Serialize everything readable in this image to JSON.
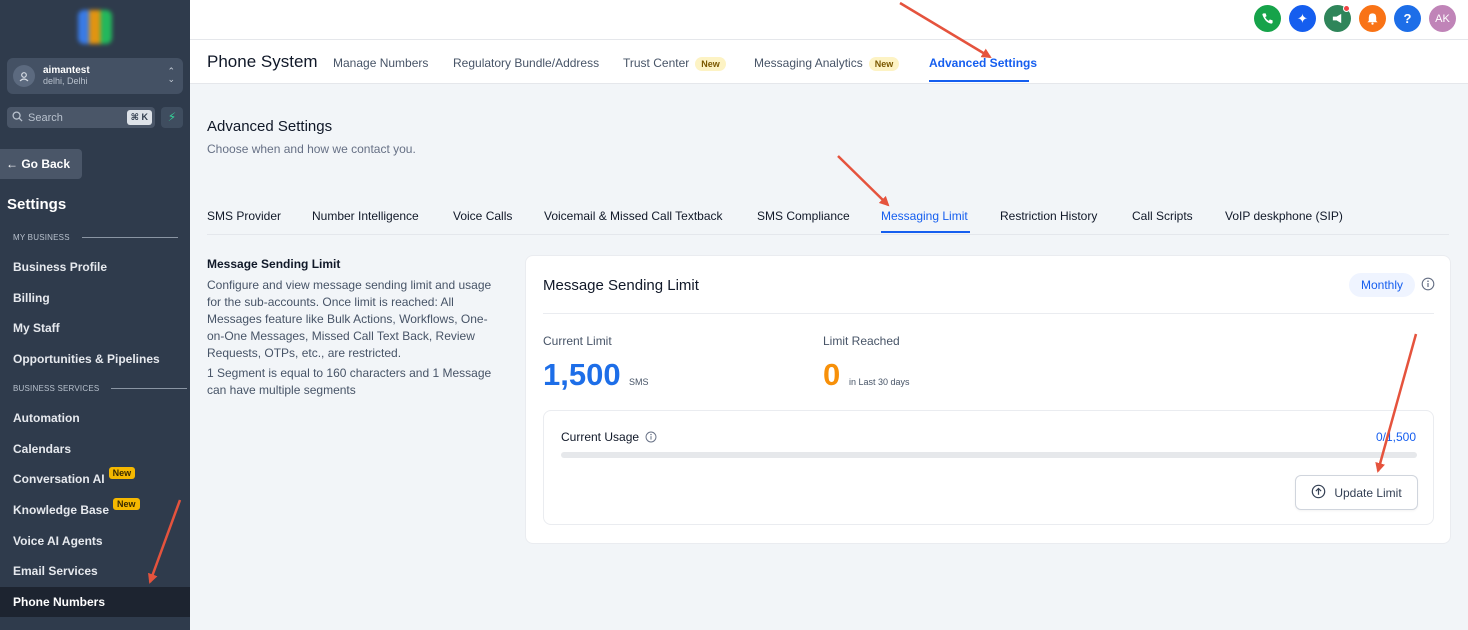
{
  "sidebar": {
    "account": {
      "name": "aimantest",
      "location": "delhi, Delhi"
    },
    "search": {
      "placeholder": "Search",
      "shortcut": "⌘ K"
    },
    "go_back": "← Go Back",
    "title": "Settings",
    "sections": [
      {
        "label": "MY BUSINESS"
      },
      {
        "label": "BUSINESS SERVICES"
      }
    ],
    "items": [
      {
        "label": "Business Profile"
      },
      {
        "label": "Billing"
      },
      {
        "label": "My Staff"
      },
      {
        "label": "Opportunities & Pipelines"
      },
      {
        "label": "Automation"
      },
      {
        "label": "Calendars"
      },
      {
        "label": "Conversation AI",
        "badge": "New"
      },
      {
        "label": "Knowledge Base",
        "badge": "New"
      },
      {
        "label": "Voice AI Agents"
      },
      {
        "label": "Email Services"
      },
      {
        "label": "Phone Numbers",
        "active": true
      }
    ]
  },
  "topbar": {
    "avatar_initials": "AK",
    "icons": [
      "phone-icon",
      "sparkle-icon",
      "megaphone-icon",
      "bell-icon",
      "help-icon"
    ]
  },
  "subnav": {
    "title": "Phone System",
    "tabs": [
      {
        "label": "Manage Numbers"
      },
      {
        "label": "Regulatory Bundle/Address"
      },
      {
        "label": "Trust Center",
        "badge": "New"
      },
      {
        "label": "Messaging Analytics",
        "badge": "New"
      },
      {
        "label": "Advanced Settings",
        "active": true
      }
    ]
  },
  "page": {
    "title": "Advanced Settings",
    "subtitle": "Choose when and how we contact you."
  },
  "tabs": [
    {
      "label": "SMS Provider"
    },
    {
      "label": "Number Intelligence"
    },
    {
      "label": "Voice Calls"
    },
    {
      "label": "Voicemail & Missed Call Textback"
    },
    {
      "label": "SMS Compliance"
    },
    {
      "label": "Messaging Limit",
      "active": true
    },
    {
      "label": "Restriction History"
    },
    {
      "label": "Call Scripts"
    },
    {
      "label": "VoIP deskphone (SIP)"
    }
  ],
  "description": {
    "title": "Message Sending Limit",
    "body": "Configure and view message sending limit and usage for the sub-accounts. Once limit is reached: All Messages feature like Bulk Actions, Workflows, One-on-One Messages, Missed Call Text Back, Review Requests, OTPs, etc., are restricted.",
    "segment_note": "1 Segment is equal to 160 characters and 1 Message can have multiple segments"
  },
  "card": {
    "title": "Message Sending Limit",
    "period": "Monthly",
    "current_limit_label": "Current Limit",
    "current_limit_value": "1,500",
    "current_limit_unit": "SMS",
    "limit_reached_label": "Limit Reached",
    "limit_reached_value": "0",
    "limit_reached_unit": "in Last 30 days",
    "usage_label": "Current Usage",
    "usage_value": "0/1,500",
    "usage_fraction": 0,
    "update_button": "Update Limit"
  },
  "colors": {
    "accent": "#155eef",
    "sidebar_bg": "#2f3b4c",
    "orange": "#f79009",
    "annotation_arrow": "#e5533d"
  }
}
